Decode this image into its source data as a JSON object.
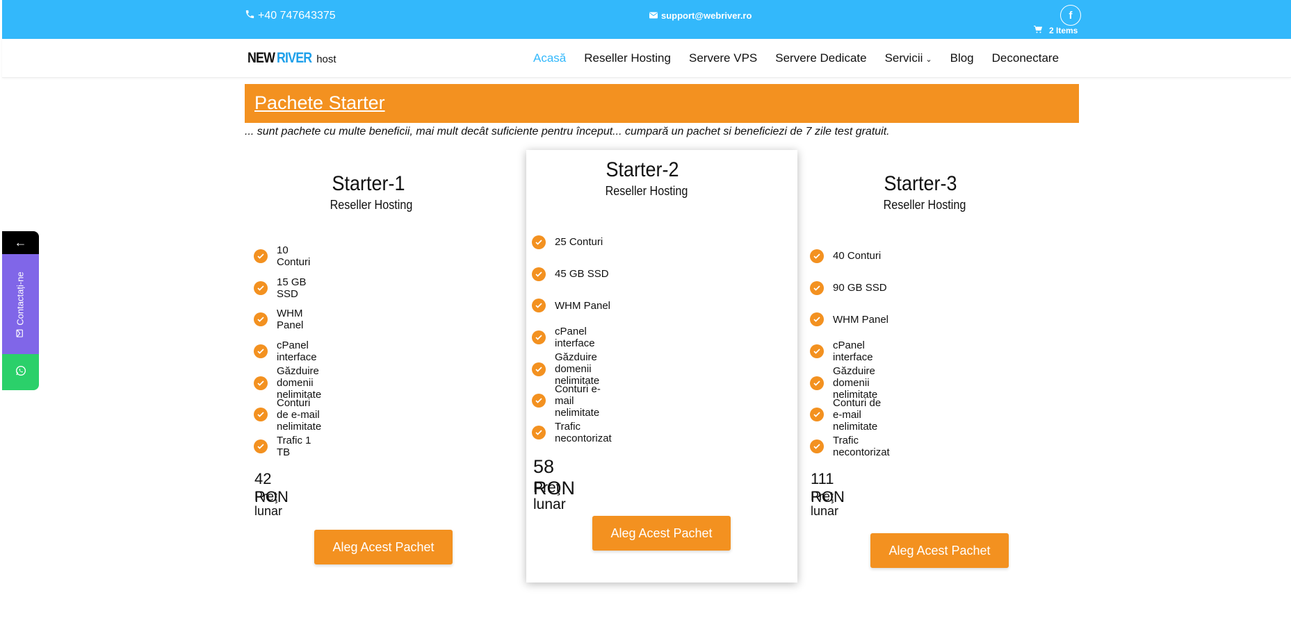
{
  "topbar": {
    "phone": "+40 747643375",
    "email": "support@webriver.ro",
    "facebook_icon": "f",
    "cart_label": "2 Items"
  },
  "header": {
    "logo": {
      "new": "NEW",
      "river": "RIVER",
      "host": "host"
    },
    "nav": [
      {
        "label": "Acasă",
        "active": true
      },
      {
        "label": "Reseller Hosting"
      },
      {
        "label": "Servere VPS"
      },
      {
        "label": "Servere Dedicate"
      },
      {
        "label": "Servicii",
        "has_dropdown": true
      },
      {
        "label": "Blog"
      },
      {
        "label": "Deconectare"
      }
    ]
  },
  "section": {
    "title": "Pachete Starter",
    "subtitle": "... sunt pachete cu multe beneficii, mai mult decât suficiente pentru început... cumpară un pachet si beneficiezi de 7 zile test gratuit."
  },
  "plans": [
    {
      "name": "Starter-1",
      "type": "Reseller Hosting",
      "features": [
        "10 Conturi",
        "15 GB SSD",
        "WHM Panel",
        "cPanel interface",
        "Găzduire domenii nelimitate",
        "Conturi de e-mail nelimitate",
        "Trafic 1 TB"
      ],
      "price": "42 RON",
      "period": "Preţ lunar",
      "button": "Aleg Acest Pachet"
    },
    {
      "name": "Starter-2",
      "type": "Reseller Hosting",
      "features": [
        "25 Conturi",
        "45 GB SSD",
        "WHM Panel",
        "cPanel interface",
        "Găzduire domenii nelimitate",
        "Conturi e-mail nelimitate",
        "Trafic necontorizat"
      ],
      "price": "58 RON",
      "period": "Preţ lunar",
      "button": "Aleg Acest Pachet"
    },
    {
      "name": "Starter-3",
      "type": "Reseller Hosting",
      "features": [
        "40 Conturi",
        "90 GB SSD",
        "WHM Panel",
        "cPanel interface",
        "Găzduire domenii nelimitate",
        "Conturi de e-mail nelimitate",
        "Trafic necontorizat"
      ],
      "price": "111 RON",
      "period": "Preţ lunar",
      "button": "Aleg Acest Pachet"
    }
  ],
  "side_widget": {
    "arrow": "←",
    "contact_label": "Contactați-ne",
    "whatsapp_icon": "whatsapp-icon"
  },
  "colors": {
    "topbar": "#33b8fb",
    "accent": "#f39120",
    "contact": "#8066e8",
    "whatsapp": "#2bd06a"
  }
}
